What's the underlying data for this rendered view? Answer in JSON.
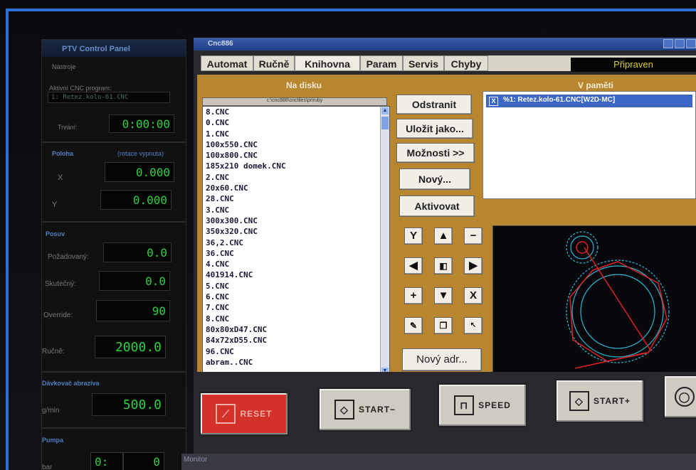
{
  "ptv": {
    "title": "PTV Control Panel",
    "menu": "Nástroje",
    "active_program_label": "Aktivní CNC program:",
    "active_program": "1: Retez.kolo-61.CNC",
    "duration_label": "Trvání:",
    "duration": "0:00:00",
    "position_section": "Poloha",
    "rotation_note": "(rotace vypnuta)",
    "x_label": "X",
    "x_value": "0.000",
    "y_label": "Y",
    "y_value": "0.000",
    "feed_section": "Posuv",
    "requested_label": "Požadovaný:",
    "requested_value": "0.0",
    "actual_label": "Skutečný:",
    "actual_value": "0.0",
    "override_label": "Override:",
    "override_value": "90",
    "manual_label": "Ručně:",
    "manual_value": "2000.0",
    "abrasive_section": "Dávkovač abraziva",
    "gmin_label": "g/min",
    "gmin_value": "500.0",
    "pump_section": "Pumpa",
    "bar_label": "bar",
    "bar_value_left": "0:",
    "bar_value_right": "0"
  },
  "window": {
    "title": "Cnc886",
    "status": "Připraven",
    "tabs": [
      "Automat",
      "Ručně",
      "Knihovna",
      "Param",
      "Servis",
      "Chyby"
    ],
    "active_tab": "Knihovna"
  },
  "library": {
    "disk_header": "Na disku",
    "memory_header": "V paměti",
    "path": "c:\\cnc886\\cncfiles\\priruby",
    "files": [
      "8.CNC",
      "0.CNC",
      "1.CNC",
      "100x550.CNC",
      "100x800.CNC",
      "185x210 domek.CNC",
      "2.CNC",
      "20x60.CNC",
      "28.CNC",
      "3.CNC",
      "300x300.CNC",
      "350x320.CNC",
      "36,2.CNC",
      "36.CNC",
      "4.CNC",
      "401914.CNC",
      "5.CNC",
      "6.CNC",
      "7.CNC",
      "8.CNC",
      "80x80xD47.CNC",
      "84x72xD55.CNC",
      "96.CNC",
      "abram..CNC"
    ],
    "buttons": {
      "remove": "Odstranit",
      "save_as": "Uložit jako...",
      "options": "Možnosti >>",
      "new": "Nový...",
      "activate": "Aktivovat",
      "new_dir": "Nový adr..."
    },
    "memory_item": "%1: Retez.kolo-61.CNC[W2D-MC]",
    "memory_checkbox": "X",
    "pad": {
      "y": "Y",
      "x": "X",
      "plus": "+",
      "minus": "−"
    }
  },
  "bottom": {
    "reset": "RESET",
    "start_minus": "START−",
    "speed": "SPEED",
    "start_plus": "START+"
  },
  "monitor": "Monitor"
}
